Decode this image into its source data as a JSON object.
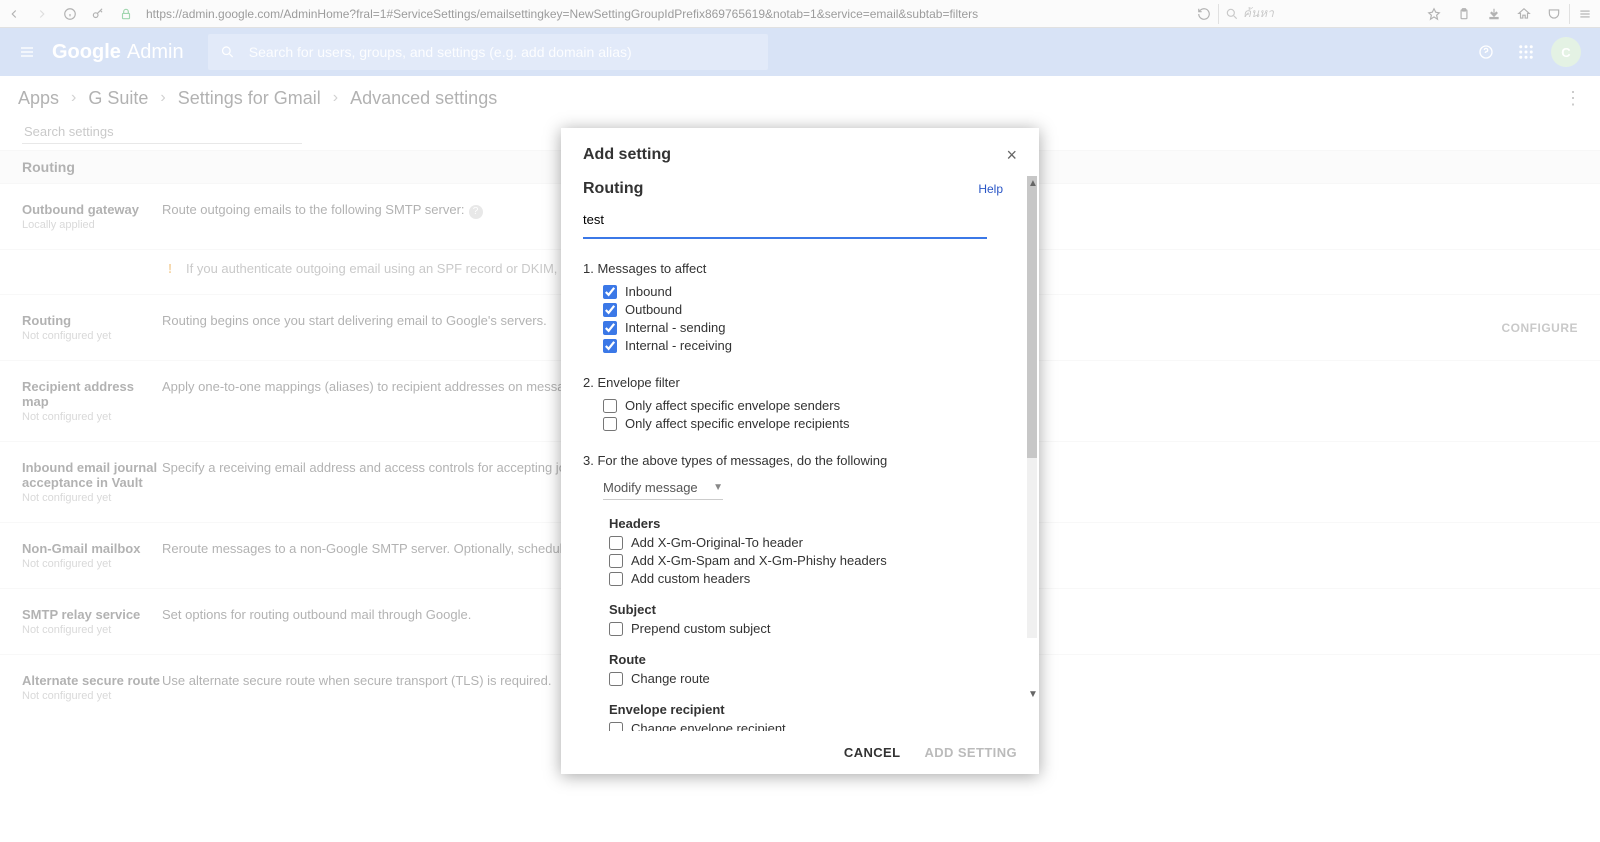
{
  "browser": {
    "url": "https://admin.google.com/AdminHome?fral=1#ServiceSettings/emailsettingkey=NewSettingGroupIdPrefix869765619&notab=1&service=email&subtab=filters",
    "search_placeholder": "ค้นหา"
  },
  "header": {
    "brand_left": "Google",
    "brand_right": "Admin",
    "search_placeholder": "Search for users, groups, and settings (e.g. add domain alias)",
    "avatar_initial": "C"
  },
  "breadcrumbs": [
    "Apps",
    "G Suite",
    "Settings for Gmail",
    "Advanced settings"
  ],
  "search_settings_placeholder": "Search settings",
  "section": {
    "title": "Routing"
  },
  "rows": {
    "outbound": {
      "title": "Outbound gateway",
      "sub": "Locally applied",
      "desc": "Route outgoing emails to the following SMTP server:"
    },
    "warn": "If you authenticate outgoing email using an SPF record or DKIM, you may",
    "routing": {
      "title": "Routing",
      "sub": "Not configured yet",
      "desc": "Routing begins once you start delivering email to Google's servers."
    },
    "ram": {
      "title": "Recipient address map",
      "sub": "Not configured yet",
      "desc": "Apply one-to-one mappings (aliases) to recipient addresses on messages rec"
    },
    "journal": {
      "titleA": "Inbound email journal",
      "titleB": "acceptance in Vault",
      "sub": "Not configured yet",
      "desc": "Specify a receiving email address and access controls for accepting journal m"
    },
    "nongmail": {
      "title": "Non-Gmail mailbox",
      "sub": "Not configured yet",
      "desc": "Reroute messages to a non-Google SMTP server. Optionally, schedule periodic"
    },
    "relay": {
      "title": "SMTP relay service",
      "sub": "Not configured yet",
      "desc": "Set options for routing outbound mail through Google."
    },
    "secure": {
      "title": "Alternate secure route",
      "sub": "Not configured yet",
      "desc": "Use alternate secure route when secure transport (TLS) is required."
    },
    "configure_label": "CONFIGURE"
  },
  "modal": {
    "heading": "Add setting",
    "title": "Routing",
    "help": "Help",
    "name_value": "test",
    "step1": "1. Messages to affect",
    "msg": {
      "inbound": "Inbound",
      "outbound": "Outbound",
      "int_send": "Internal - sending",
      "int_recv": "Internal - receiving"
    },
    "step2": "2. Envelope filter",
    "env": {
      "senders": "Only affect specific envelope senders",
      "recips": "Only affect specific envelope recipients"
    },
    "step3": "3. For the above types of messages, do the following",
    "action_select": "Modify message",
    "grp_headers": "Headers",
    "h1": "Add X-Gm-Original-To header",
    "h2": "Add X-Gm-Spam and X-Gm-Phishy headers",
    "h3": "Add custom headers",
    "grp_subject": "Subject",
    "s1": "Prepend custom subject",
    "grp_route": "Route",
    "r1": "Change route",
    "grp_envrec": "Envelope recipient",
    "e1": "Change envelope recipient",
    "cancel": "CANCEL",
    "add": "ADD SETTING"
  }
}
